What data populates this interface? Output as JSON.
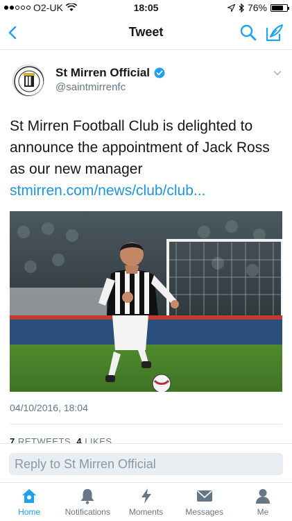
{
  "status": {
    "carrier": "O2-UK",
    "time": "18:05",
    "battery": "76%",
    "battery_level": 0.76
  },
  "nav": {
    "title": "Tweet"
  },
  "tweet": {
    "author_name": "St Mirren Official",
    "author_handle": "@saintmirrenfc",
    "text": "St Mirren Football Club is delighted to announce the appointment of Jack Ross as our new manager",
    "link": "stmirren.com/news/club/club...",
    "timestamp": "04/10/2016, 18:04",
    "retweets_count": "7",
    "retweets_label": "RETWEETS",
    "likes_count": "4",
    "likes_label": "LIKES"
  },
  "reply": {
    "placeholder": "Reply to St Mirren Official"
  },
  "tabs": [
    {
      "label": "Home",
      "icon": "home-icon"
    },
    {
      "label": "Notifications",
      "icon": "bell-icon"
    },
    {
      "label": "Moments",
      "icon": "lightning-icon"
    },
    {
      "label": "Messages",
      "icon": "envelope-icon"
    },
    {
      "label": "Me",
      "icon": "person-icon"
    }
  ],
  "colors": {
    "accent": "#1da1f2",
    "link": "#1b95e0",
    "muted": "#657786"
  }
}
